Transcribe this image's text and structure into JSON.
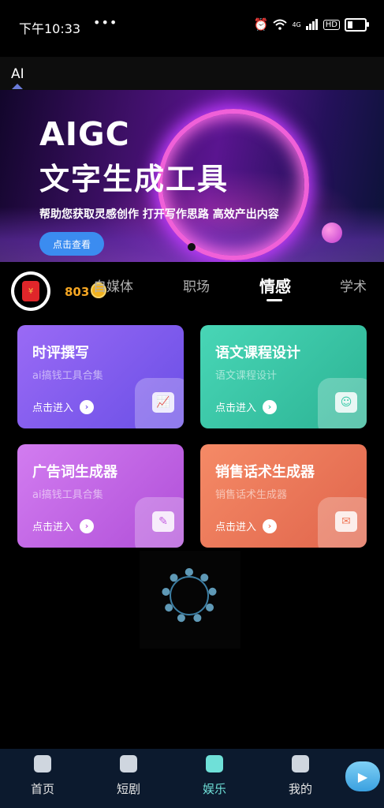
{
  "status": {
    "time": "下午10:33",
    "dots": "•••",
    "network": "4G",
    "hd": "HD"
  },
  "top_tab": {
    "label": "AI"
  },
  "banner": {
    "title_line1": "AIGC",
    "title_line2": "文字生成工具",
    "subtitle": "帮助您获取灵感创作 打开写作思路 高效产出内容",
    "button": "点击查看"
  },
  "user": {
    "coins": "803"
  },
  "categories": [
    {
      "label": "自媒体",
      "active": false
    },
    {
      "label": "职场",
      "active": false
    },
    {
      "label": "情感",
      "active": true
    },
    {
      "label": "学术",
      "active": false
    }
  ],
  "cards": [
    {
      "title": "时评撰写",
      "subtitle": "ai搞钱工具合集",
      "action": "点击进入",
      "icon": "chart-icon",
      "color": "#7b5cf0"
    },
    {
      "title": "语文课程设计",
      "subtitle": "语文课程设计",
      "action": "点击进入",
      "icon": "head-icon",
      "color": "#34c9a6"
    },
    {
      "title": "广告词生成器",
      "subtitle": "ai搞钱工具合集",
      "action": "点击进入",
      "icon": "edit-icon",
      "color": "#c45ee0"
    },
    {
      "title": "销售话术生成器",
      "subtitle": "销售话术生成器",
      "action": "点击进入",
      "icon": "speech-icon",
      "color": "#f07a5c"
    }
  ],
  "nav": [
    {
      "label": "首页",
      "active": false,
      "icon": "home-icon"
    },
    {
      "label": "短剧",
      "active": false,
      "icon": "clapper-icon"
    },
    {
      "label": "娱乐",
      "active": true,
      "icon": "doc-icon"
    },
    {
      "label": "我的",
      "active": false,
      "icon": "robot-icon"
    }
  ],
  "colors": {
    "accent": "#6fe0d8",
    "coin": "#f5a623",
    "banner_button": "#3b8cf0"
  }
}
